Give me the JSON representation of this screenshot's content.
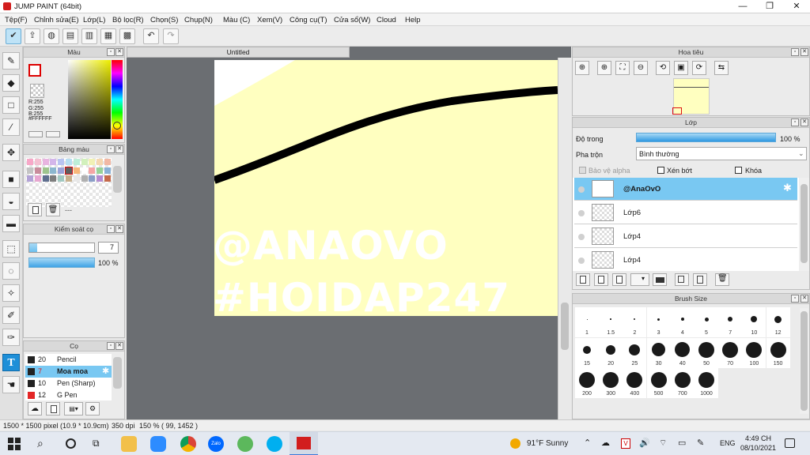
{
  "window": {
    "title": "JUMP PAINT (64bit)",
    "min": "—",
    "max": "❐",
    "close": "✕"
  },
  "menu": [
    "Tệp(F)",
    "Chỉnh sửa(E)",
    "Lớp(L)",
    "Bộ lọc(R)",
    "Chọn(S)",
    "Chụp(N)",
    "Màu (C)",
    "Xem(V)",
    "Công cụ(T)",
    "Cửa sổ(W)",
    "Cloud",
    "Help"
  ],
  "color_panel": {
    "title": "Màu",
    "r": "R:255",
    "g": "G:255",
    "b": "B:255",
    "hex": "#FFFFFF",
    "fg": "#ffffff",
    "bg": "#ffffff"
  },
  "palette_panel": {
    "title": "Bảng màu",
    "dots": "---",
    "swatches": [
      "#f7a8c8",
      "#f4c0d2",
      "#e8b4e0",
      "#d3b6ea",
      "#b8c4f1",
      "#b8dff2",
      "#bdeed8",
      "#d2f0bc",
      "#f1f1b5",
      "#f5d7b1",
      "#f2b8a4",
      "#c4c4c4",
      "#c98c9c",
      "#9fc48e",
      "#8cb7cf",
      "#9aa3d9",
      "#5f5f5f",
      "#f7b87a",
      "#ffffff",
      "#f5a5a5",
      "#98d298",
      "#8ab1d6",
      "#b3a3d6",
      "#e8a7d0",
      "#5f6f8f",
      "#7e7e7e",
      "#a1c9c1",
      "#c7b18e",
      "#e8e8e8",
      "#b0b0b0",
      "#8a9ec7",
      "#b48bd0",
      "#c56a4b"
    ]
  },
  "brush_control": {
    "title": "Kiểm soát cọ",
    "size": "7",
    "opacity": "100 %"
  },
  "brush_panel": {
    "title": "Cọ",
    "items": [
      {
        "size": "20",
        "name": "Pencil",
        "color": "#222222"
      },
      {
        "size": "7",
        "name": "Moa moa",
        "color": "#222222"
      },
      {
        "size": "10",
        "name": "Pen (Sharp)",
        "color": "#222222"
      },
      {
        "size": "12",
        "name": "G Pen",
        "color": "#e32626"
      }
    ]
  },
  "document": {
    "tab": "Untitled",
    "watermark1": "@ANAOVO",
    "watermark2": "#HOIDAP247"
  },
  "navigator": {
    "title": "Hoa tiêu"
  },
  "layer_panel": {
    "title": "Lớp",
    "opacity_label": "Độ trong",
    "opacity": "100 %",
    "blend_label": "Pha trộn",
    "blend": "Bình thường",
    "protect_alpha": "Bảo vệ alpha",
    "clipping": "Xén bớt",
    "lock": "Khóa",
    "layers": [
      {
        "name": "@AnaOvO"
      },
      {
        "name": "Lớp6"
      },
      {
        "name": "Lớp4"
      },
      {
        "name": "Lớp4"
      }
    ]
  },
  "brush_size": {
    "title": "Brush Size",
    "sizes": [
      "1",
      "1.5",
      "2",
      "3",
      "4",
      "5",
      "7",
      "10",
      "12",
      "15",
      "20",
      "25",
      "30",
      "40",
      "50",
      "70",
      "100",
      "150",
      "200",
      "300",
      "400",
      "500",
      "700",
      "1000"
    ]
  },
  "status": {
    "size": "1500 * 1500 pixel",
    "cm": "(10.9 * 10.9cm)",
    "dpi": "350 dpi",
    "zoom": "150 %",
    "coords": "( 99, 1452 )"
  },
  "taskbar": {
    "weather": "91°F  Sunny",
    "lang": "ENG",
    "time": "4:49 CH",
    "date": "08/10/2021",
    "zalo": "Zalo"
  }
}
